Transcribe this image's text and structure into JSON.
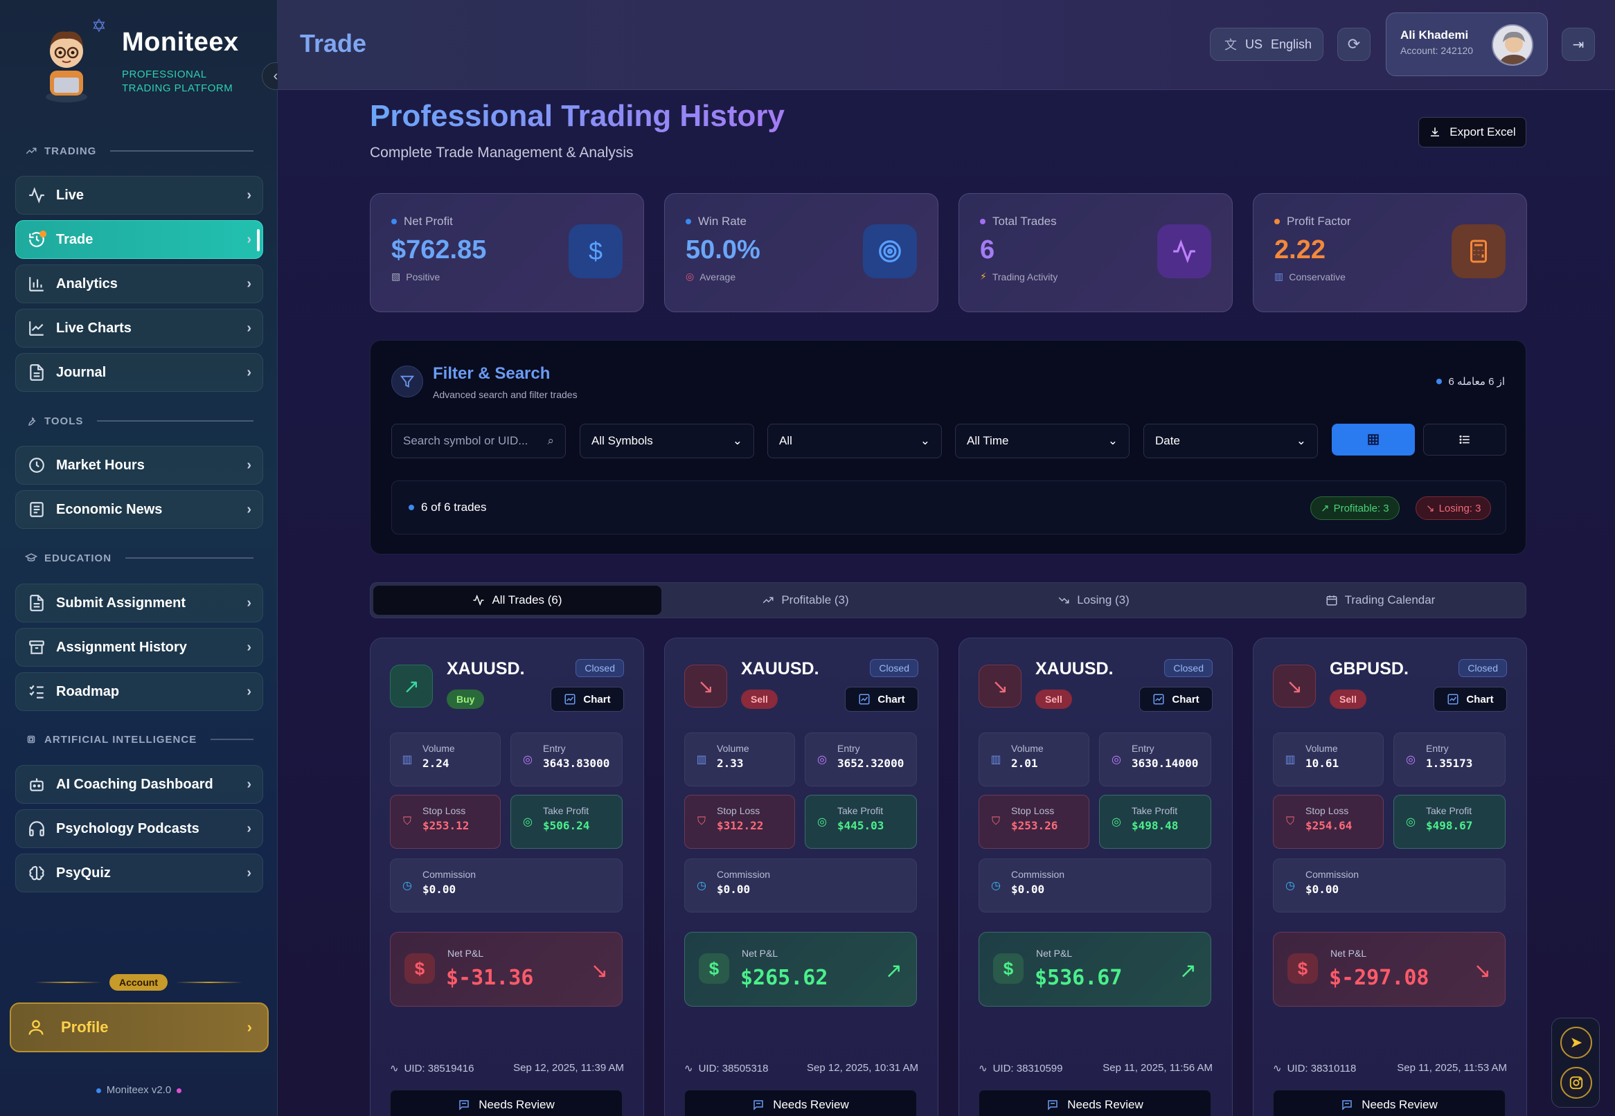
{
  "app": {
    "name": "Moniteex",
    "tagline": "PROFESSIONAL TRADING PLATFORM",
    "version": "Moniteex v2.0"
  },
  "sidebar": {
    "sections": [
      {
        "title": "TRADING",
        "icon": "trending-up-icon"
      },
      {
        "title": "TOOLS",
        "icon": "wrench-icon"
      },
      {
        "title": "EDUCATION",
        "icon": "graduation-cap-icon"
      },
      {
        "title": "ARTIFICIAL INTELLIGENCE",
        "icon": "cpu-icon"
      }
    ],
    "items": [
      {
        "label": "Live",
        "icon": "activity-icon"
      },
      {
        "label": "Trade",
        "icon": "history-icon",
        "active": true
      },
      {
        "label": "Analytics",
        "icon": "bar-chart-icon"
      },
      {
        "label": "Live Charts",
        "icon": "line-chart-icon"
      },
      {
        "label": "Journal",
        "icon": "file-text-icon"
      },
      {
        "label": "Market Hours",
        "icon": "clock-icon"
      },
      {
        "label": "Economic News",
        "icon": "newspaper-icon"
      },
      {
        "label": "Submit Assignment",
        "icon": "file-text-icon"
      },
      {
        "label": "Assignment History",
        "icon": "archive-icon"
      },
      {
        "label": "Roadmap",
        "icon": "list-checks-icon"
      },
      {
        "label": "AI Coaching Dashboard",
        "icon": "bot-icon"
      },
      {
        "label": "Psychology Podcasts",
        "icon": "headphones-icon"
      },
      {
        "label": "PsyQuiz",
        "icon": "brain-icon"
      }
    ],
    "account_badge": "Account",
    "profile_label": "Profile"
  },
  "header": {
    "title": "Trade",
    "language": {
      "flag": "US",
      "label": "English"
    },
    "user": {
      "name": "Ali Khademi",
      "account": "Account: 242120"
    }
  },
  "hero": {
    "title": "Professional Trading History",
    "subtitle": "Complete Trade Management & Analysis",
    "export_label": "Export Excel"
  },
  "stats": [
    {
      "label": "Net Profit",
      "value": "$762.85",
      "sub": "Positive",
      "dot": "#3a8af0",
      "value_color": "#6aa6f8",
      "icon": "dollar-icon"
    },
    {
      "label": "Win Rate",
      "value": "50.0%",
      "sub": "Average",
      "dot": "#3a8af0",
      "value_color": "#6aa6f8",
      "icon": "target-icon"
    },
    {
      "label": "Total Trades",
      "value": "6",
      "sub": "Trading Activity",
      "dot": "#a070f0",
      "value_color": "#a47cf4",
      "icon": "pulse-icon"
    },
    {
      "label": "Profit Factor",
      "value": "2.22",
      "sub": "Conservative",
      "dot": "#f08a3a",
      "value_color": "#f4883a",
      "icon": "calculator-icon"
    }
  ],
  "filter": {
    "title": "Filter & Search",
    "subtitle": "Advanced search and filter trades",
    "count_text": "از 6 معامله 6",
    "search_placeholder": "Search symbol or UID...",
    "symbols": "All Symbols",
    "type": "All",
    "time": "All Time",
    "sort": "Date",
    "summary": "6 of 6 trades",
    "profitable_pill": "Profitable: 3",
    "losing_pill": "Losing: 3"
  },
  "tabs": [
    {
      "label": "All Trades (6)",
      "icon": "pulse-icon",
      "active": true
    },
    {
      "label": "Profitable (3)",
      "icon": "trending-up-icon"
    },
    {
      "label": "Losing (3)",
      "icon": "trending-down-icon"
    },
    {
      "label": "Trading Calendar",
      "icon": "calendar-icon"
    }
  ],
  "labels": {
    "closed": "Closed",
    "chart": "Chart",
    "volume": "Volume",
    "entry": "Entry",
    "stop_loss": "Stop Loss",
    "take_profit": "Take Profit",
    "commission": "Commission",
    "net_pnl": "Net P&L",
    "needs_review": "Needs Review"
  },
  "trades": [
    {
      "symbol": "XAUUSD.",
      "side": "Buy",
      "volume": "2.24",
      "entry": "3643.83000",
      "stop_loss": "$253.12",
      "take_profit": "$506.24",
      "commission": "$0.00",
      "net_pnl": "$-31.36",
      "uid": "UID: 38519416",
      "date": "Sep 12, 2025, 11:39 AM",
      "profitable": false
    },
    {
      "symbol": "XAUUSD.",
      "side": "Sell",
      "volume": "2.33",
      "entry": "3652.32000",
      "stop_loss": "$312.22",
      "take_profit": "$445.03",
      "commission": "$0.00",
      "net_pnl": "$265.62",
      "uid": "UID: 38505318",
      "date": "Sep 12, 2025, 10:31 AM",
      "profitable": true
    },
    {
      "symbol": "XAUUSD.",
      "side": "Sell",
      "volume": "2.01",
      "entry": "3630.14000",
      "stop_loss": "$253.26",
      "take_profit": "$498.48",
      "commission": "$0.00",
      "net_pnl": "$536.67",
      "uid": "UID: 38310599",
      "date": "Sep 11, 2025, 11:56 AM",
      "profitable": true
    },
    {
      "symbol": "GBPUSD.",
      "side": "Sell",
      "volume": "10.61",
      "entry": "1.35173",
      "stop_loss": "$254.64",
      "take_profit": "$498.67",
      "commission": "$0.00",
      "net_pnl": "$-297.08",
      "uid": "UID: 38310118",
      "date": "Sep 11, 2025, 11:53 AM",
      "profitable": false
    }
  ]
}
